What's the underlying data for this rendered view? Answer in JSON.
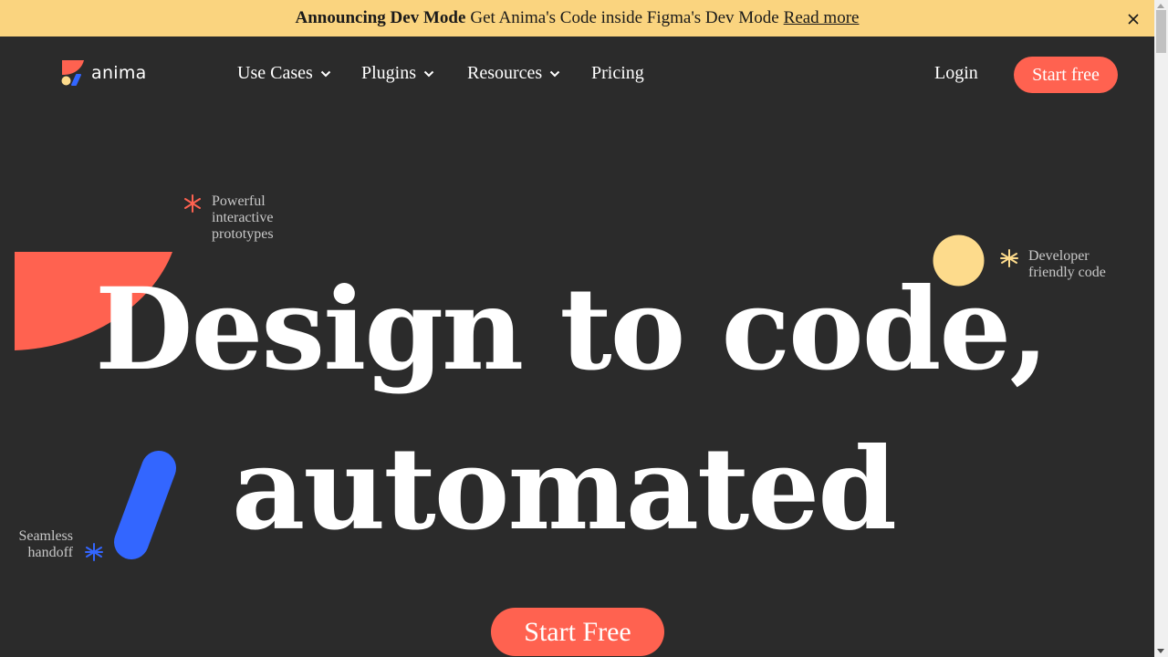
{
  "banner": {
    "bold": "Announcing Dev Mode",
    "text": "Get Anima's Code inside Figma's Dev Mode",
    "link": "Read more",
    "close_icon": "close-icon"
  },
  "nav": {
    "logo_text": "anima",
    "items": [
      {
        "label": "Use Cases",
        "has_dropdown": true
      },
      {
        "label": "Plugins",
        "has_dropdown": true
      },
      {
        "label": "Resources",
        "has_dropdown": true
      },
      {
        "label": "Pricing",
        "has_dropdown": false
      }
    ],
    "login": "Login",
    "start": "Start free"
  },
  "hero": {
    "line1": "Design to code,",
    "line2": "automated",
    "features": {
      "prototypes": [
        "Powerful",
        "interactive",
        "prototypes"
      ],
      "code": [
        "Developer",
        "friendly code"
      ],
      "handoff": [
        "Seamless",
        "handoff"
      ]
    },
    "cta": "Start Free"
  },
  "colors": {
    "brand_red": "#ff6250",
    "brand_yellow": "#fddb8c",
    "brand_blue": "#3366ff",
    "banner_bg": "#fad47f",
    "background": "#2b2b2b"
  }
}
